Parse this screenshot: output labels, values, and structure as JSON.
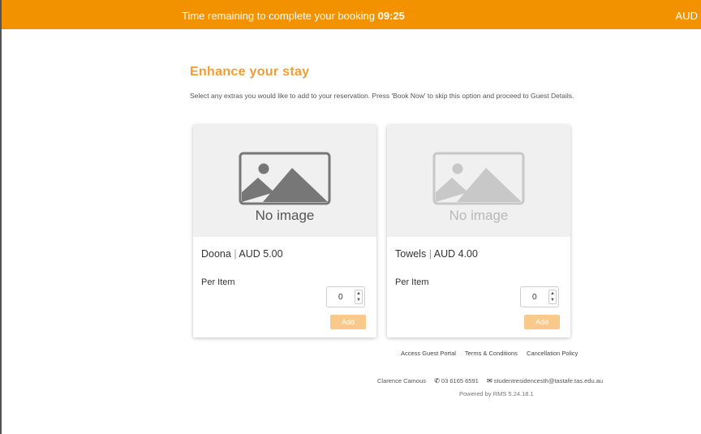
{
  "topbar": {
    "timer_label": "Time remaining to complete your booking",
    "timer_value": "09:25",
    "currency": "AUD"
  },
  "page": {
    "heading": "Enhance your stay",
    "intro": "Select any extras you would like to add to your reservation. Press 'Book Now' to skip this option and proceed to Guest Details."
  },
  "extras": [
    {
      "no_image_text": "No image",
      "name": "Doona",
      "separator": "|",
      "price": "AUD 5.00",
      "unit": "Per Item",
      "quantity": "0",
      "add_label": "Add"
    },
    {
      "no_image_text": "No image",
      "name": "Towels",
      "separator": "|",
      "price": "AUD 4.00",
      "unit": "Per Item",
      "quantity": "0",
      "add_label": "Add"
    }
  ],
  "footer": {
    "links": [
      "Access Guest Portal",
      "Terms & Conditions",
      "Cancellation Policy"
    ],
    "contact_name": "Clarence Camous",
    "phone": "03 6165 6591",
    "email": "studentresidencesth@tastafe.tas.edu.au",
    "powered_by": "Powered by RMS 5.24.18.1"
  },
  "icons": {
    "phone": "phone-icon",
    "email": "envelope-icon",
    "placeholder": "image-placeholder-icon"
  },
  "colors": {
    "brand_orange": "#f39200",
    "heading_orange": "#f39c33",
    "add_button": "#f9c98a"
  }
}
